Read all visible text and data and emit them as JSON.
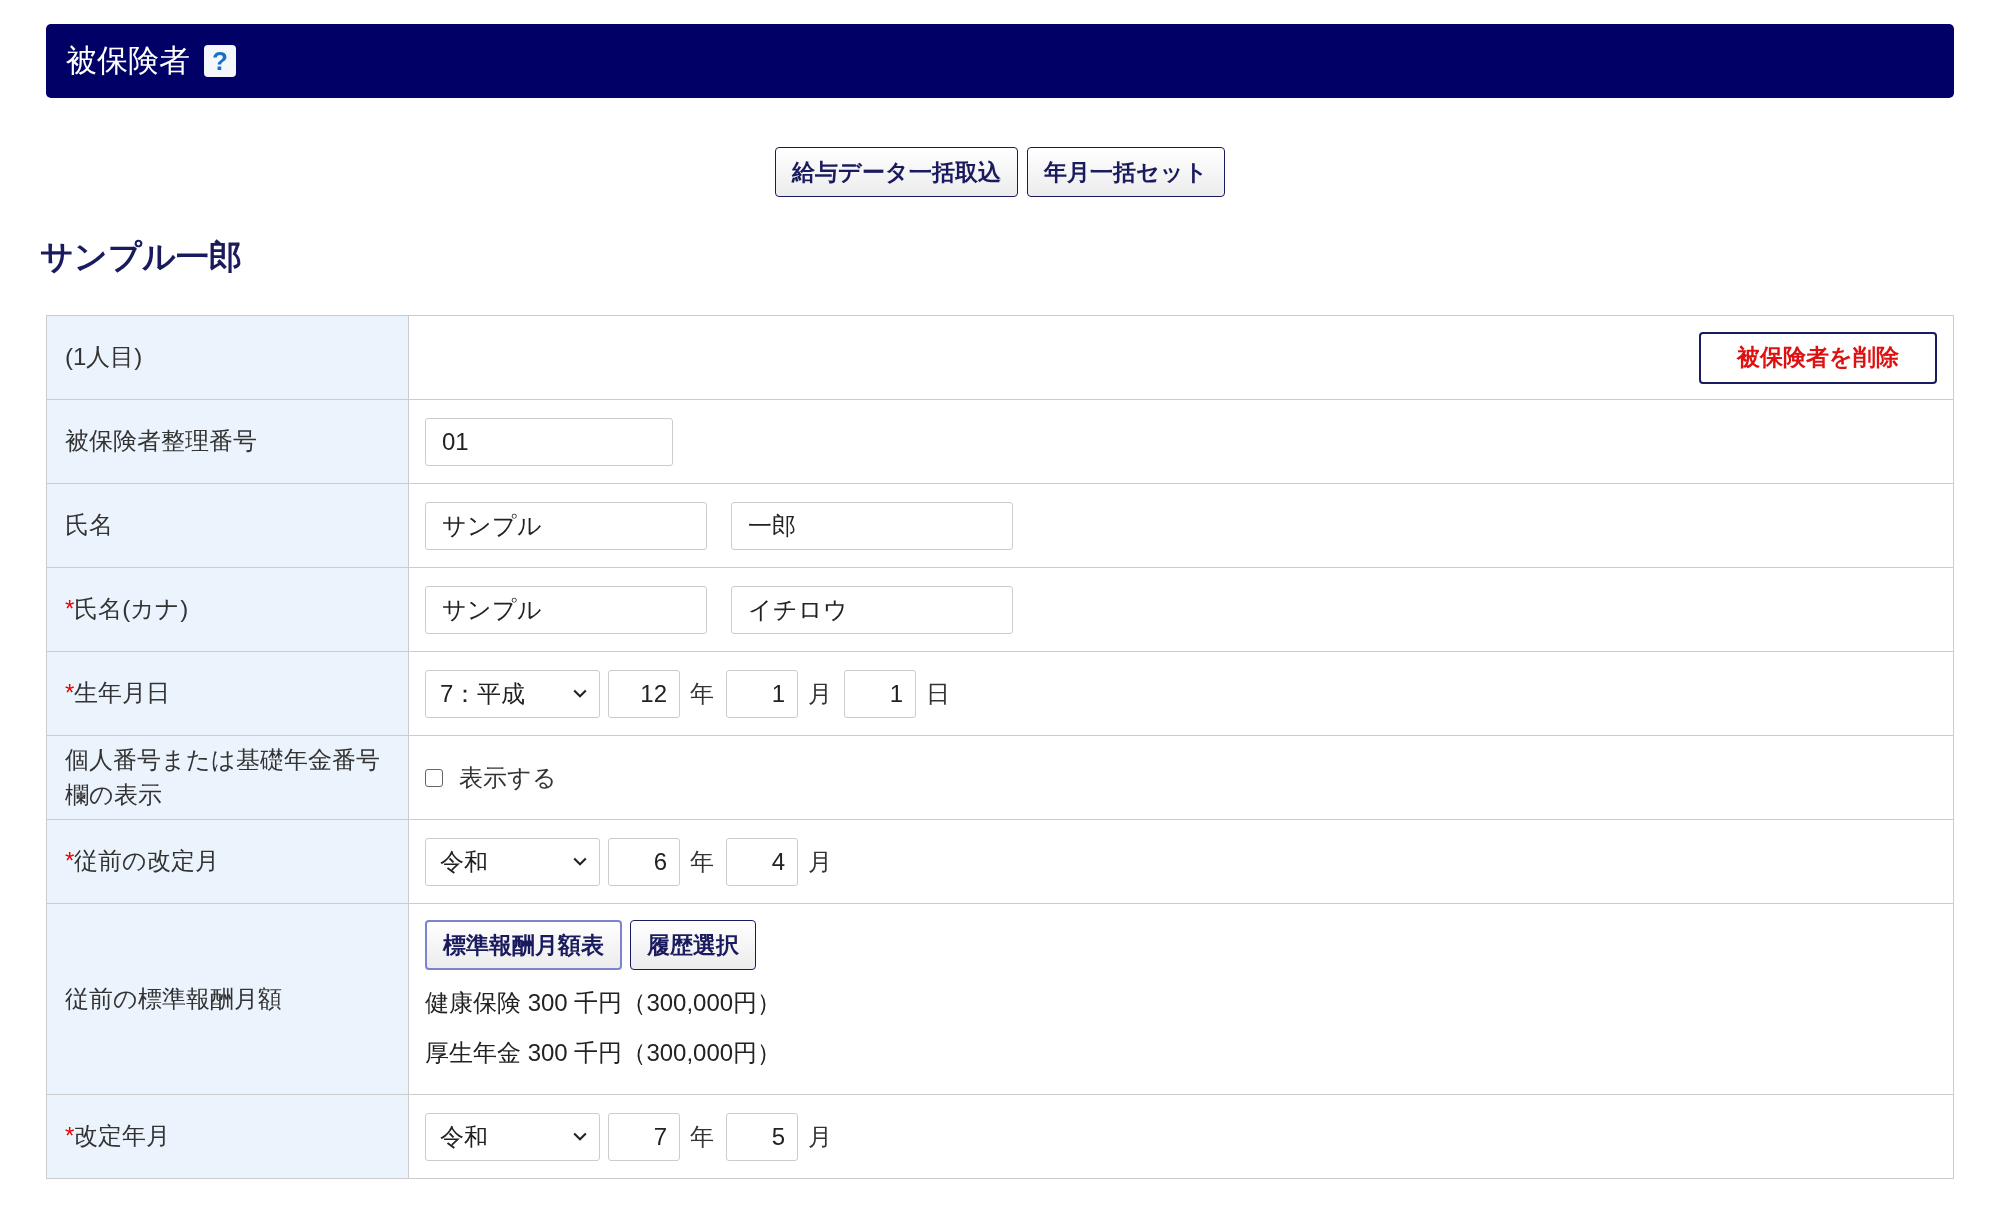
{
  "header": {
    "title": "被保険者",
    "help": "?"
  },
  "toolbar": [
    "給与データ一括取込",
    "年月一括セット"
  ],
  "person_name": "サンプル一郎",
  "rows": [
    {
      "kind": "delete",
      "label": "(1人目)",
      "button": "被保険者を削除"
    },
    {
      "kind": "inputs",
      "label": "被保険者整理番号",
      "inputs": [
        "01"
      ]
    },
    {
      "kind": "inputs",
      "label": "氏名",
      "inputs": [
        "サンプル",
        "一郎"
      ]
    },
    {
      "kind": "inputs",
      "required_mark": "*",
      "label": "氏名(カナ)",
      "inputs": [
        "サンプル",
        "イチロウ"
      ]
    },
    {
      "kind": "date",
      "required_mark": "*",
      "label": "生年月日",
      "select": "7：平成",
      "parts": [
        {
          "value": "12",
          "unit": "年"
        },
        {
          "value": "1",
          "unit": "月"
        },
        {
          "value": "1",
          "unit": "日"
        }
      ]
    },
    {
      "kind": "checkbox",
      "label": "個人番号または基礎年金番号欄の表示",
      "checked": false,
      "text": "表示する"
    },
    {
      "kind": "date",
      "required_mark": "*",
      "label": "従前の改定月",
      "select": "令和",
      "parts": [
        {
          "value": "6",
          "unit": "年"
        },
        {
          "value": "4",
          "unit": "月"
        }
      ]
    },
    {
      "kind": "salary",
      "label": "従前の標準報酬月額",
      "buttons": [
        "標準報酬月額表",
        "履歴選択"
      ],
      "lines": [
        "健康保険 300 千円（300,000円）",
        "厚生年金 300 千円（300,000円）"
      ]
    },
    {
      "kind": "date",
      "required_mark": "*",
      "label": "改定年月",
      "select": "令和",
      "parts": [
        {
          "value": "7",
          "unit": "年"
        },
        {
          "value": "5",
          "unit": "月"
        }
      ]
    }
  ]
}
